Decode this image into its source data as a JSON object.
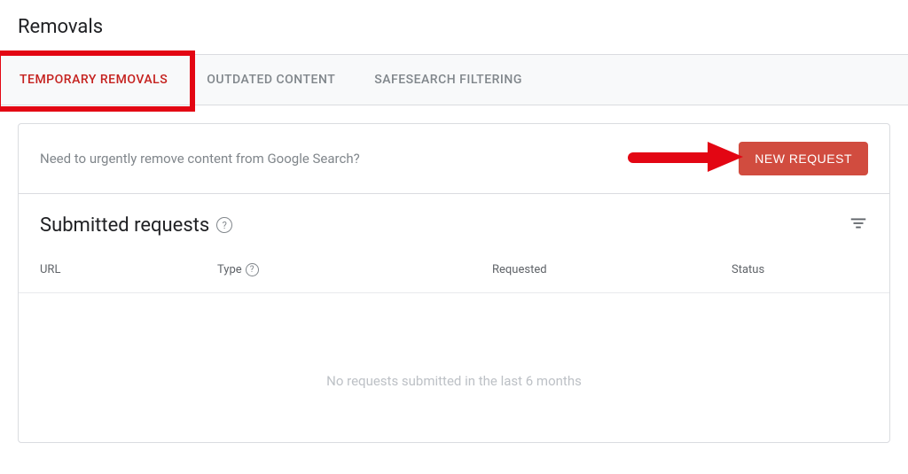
{
  "page": {
    "title": "Removals"
  },
  "tabs": {
    "items": [
      {
        "label": "TEMPORARY REMOVALS"
      },
      {
        "label": "OUTDATED CONTENT"
      },
      {
        "label": "SAFESEARCH FILTERING"
      }
    ]
  },
  "card": {
    "prompt": "Need to urgently remove content from Google Search?",
    "new_request_label": "NEW REQUEST"
  },
  "section": {
    "title": "Submitted requests"
  },
  "table": {
    "headers": {
      "url": "URL",
      "type": "Type",
      "requested": "Requested",
      "status": "Status"
    },
    "empty_message": "No requests submitted in the last 6 months"
  }
}
